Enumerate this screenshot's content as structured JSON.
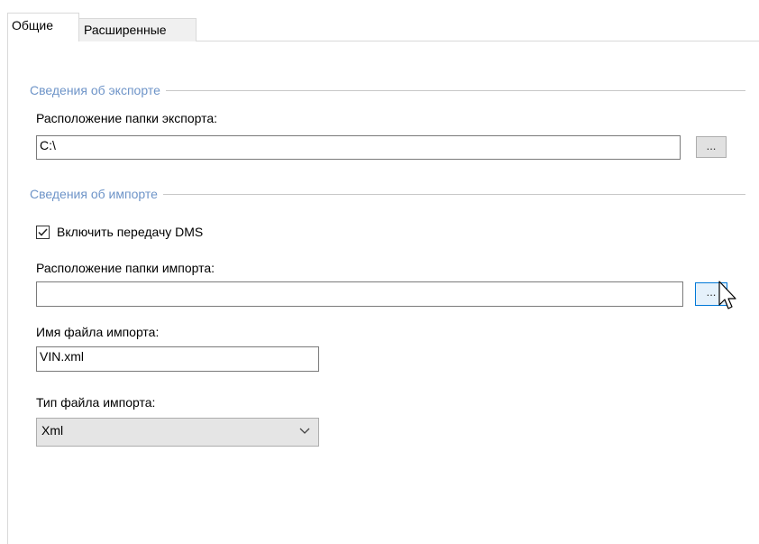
{
  "tabs": [
    {
      "label": "Общие",
      "active": true
    },
    {
      "label": "Расширенные",
      "active": false
    }
  ],
  "export_section": {
    "title": "Сведения об экспорте",
    "folder_label": "Расположение папки экспорта:",
    "folder_value": "C:\\",
    "browse_label": "..."
  },
  "import_section": {
    "title": "Сведения об импорте",
    "enable_dms_label": "Включить передачу DMS",
    "enable_dms_checked": true,
    "folder_label": "Расположение папки импорта:",
    "folder_value": "",
    "browse_label": "...",
    "filename_label": "Имя файла импорта:",
    "filename_value": "VIN.xml",
    "filetype_label": "Тип файла импорта:",
    "filetype_value": "Xml"
  },
  "colors": {
    "group_title": "#6e94c8",
    "hover_border": "#0078d7"
  },
  "icons": {
    "checkbox": "checkmark-icon",
    "dropdown": "chevron-down-icon",
    "cursor": "mouse-pointer-icon"
  }
}
